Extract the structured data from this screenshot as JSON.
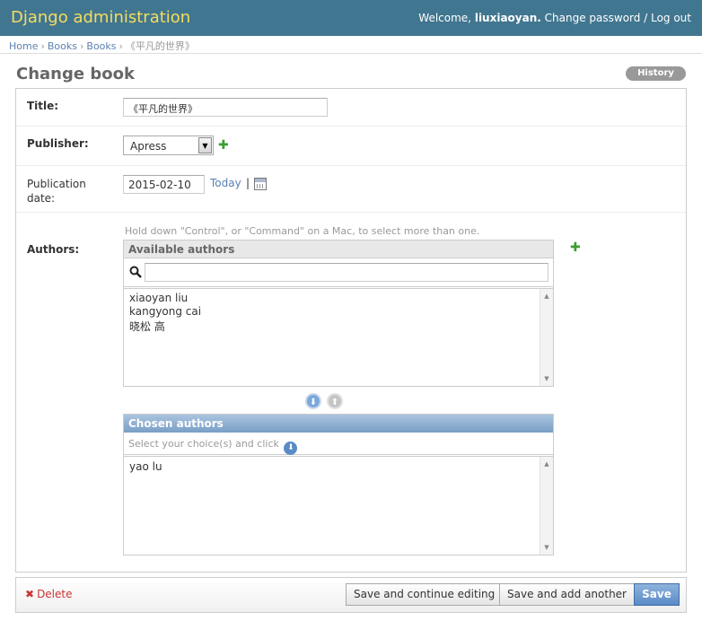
{
  "header": {
    "branding": "Django administration",
    "welcome": "Welcome,",
    "username": "liuxiaoyan.",
    "change_password": "Change password",
    "sep": "/",
    "logout": "Log out"
  },
  "breadcrumbs": {
    "home": "Home",
    "app": "Books",
    "model": "Books",
    "current": "《平凡的世界》",
    "sep": "›"
  },
  "page": {
    "title": "Change book",
    "history": "History"
  },
  "form": {
    "title_label": "Title:",
    "title_value": "《平凡的世界》",
    "publisher_label": "Publisher:",
    "publisher_value": "Apress",
    "pubdate_label": "Publication date:",
    "pubdate_value": "2015-02-10",
    "today": "Today",
    "pipe": "|",
    "authors_label": "Authors:",
    "help_text": "Hold down \"Control\", or \"Command\" on a Mac, to select more than one.",
    "add_glyph": "✚"
  },
  "available": {
    "header": "Available authors",
    "items": [
      "xiaoyan liu",
      "kangyong cai",
      "晓松 高"
    ]
  },
  "chosen": {
    "header": "Chosen authors",
    "help": "Select your choice(s) and click",
    "items": [
      "yao lu"
    ]
  },
  "submit": {
    "delete": "Delete",
    "save_continue": "Save and continue editing",
    "save_add": "Save and add another",
    "save": "Save"
  },
  "colors": {
    "header_bg": "#417690",
    "branding": "#f5dd5d",
    "link": "#5b80b2",
    "delete": "#cc3333",
    "add_green": "#3a9e2f"
  }
}
